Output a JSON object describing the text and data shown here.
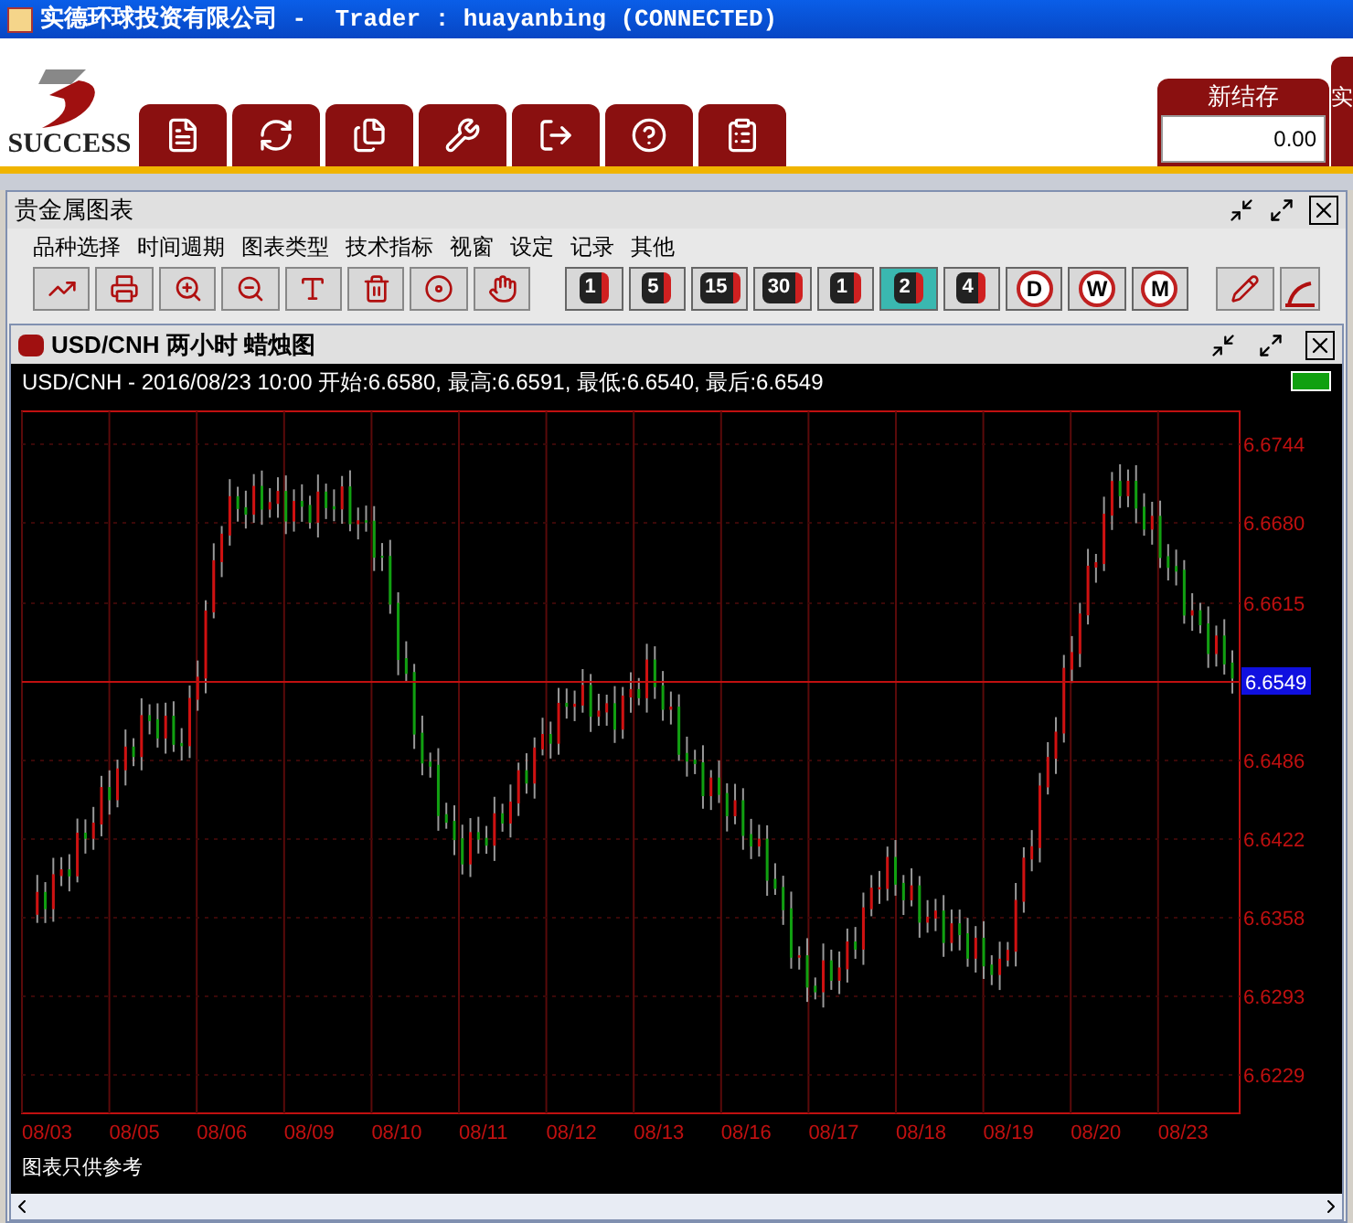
{
  "window": {
    "title": "实德环球投资有限公司 -  Trader : huayanbing (CONNECTED)"
  },
  "logo": {
    "text": "SUCCESS"
  },
  "balance": {
    "label": "新结存",
    "value": "0.00",
    "next_label": "实"
  },
  "panel": {
    "title": "贵金属图表",
    "menu": [
      "品种选择",
      "时间週期",
      "图表类型",
      "技术指标",
      "视窗",
      "设定",
      "记录",
      "其他"
    ],
    "timeframes": [
      {
        "label": "1",
        "kind": "clock",
        "selected": false
      },
      {
        "label": "5",
        "kind": "clock",
        "selected": false
      },
      {
        "label": "15",
        "kind": "clock",
        "selected": false
      },
      {
        "label": "30",
        "kind": "clock",
        "selected": false
      },
      {
        "label": "1",
        "kind": "clock",
        "selected": false
      },
      {
        "label": "2",
        "kind": "clock",
        "selected": true
      },
      {
        "label": "4",
        "kind": "clock",
        "selected": false
      },
      {
        "label": "D",
        "kind": "circle",
        "selected": false
      },
      {
        "label": "W",
        "kind": "circle",
        "selected": false
      },
      {
        "label": "M",
        "kind": "circle",
        "selected": false
      }
    ]
  },
  "chart_window": {
    "title": "USD/CNH 两小时 蜡烛图",
    "info": "USD/CNH - 2016/08/23 10:00 开始:6.6580, 最高:6.6591, 最低:6.6540, 最后:6.6549",
    "y_labels": [
      "6.6744",
      "6.6680",
      "6.6615",
      "6.6486",
      "6.6422",
      "6.6358",
      "6.6293",
      "6.6229"
    ],
    "current_price": "6.6549",
    "x_labels": [
      "08/03",
      "08/05",
      "08/06",
      "08/09",
      "08/10",
      "08/11",
      "08/12",
      "08/13",
      "08/16",
      "08/17",
      "08/18",
      "08/19",
      "08/20",
      "08/23"
    ],
    "note": "图表只供参考"
  }
}
